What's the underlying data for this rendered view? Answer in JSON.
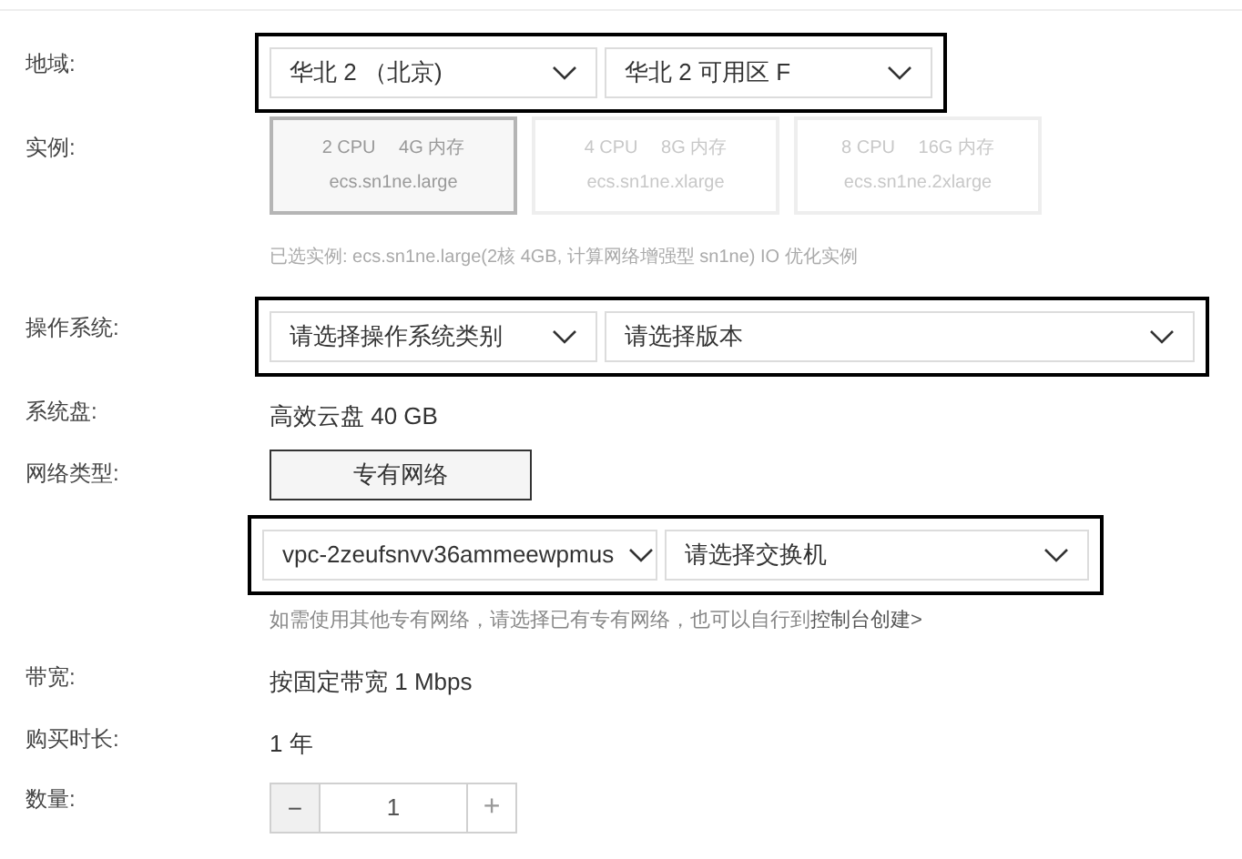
{
  "fields": [
    {
      "kind": "selects",
      "label": "地域:",
      "outlined": true,
      "selects": [
        {
          "text": "华北 2 （北京)",
          "wide": false
        },
        {
          "text": "华北 2 可用区 F",
          "wide": false
        }
      ]
    },
    {
      "kind": "instances",
      "label": "实例:",
      "options": [
        {
          "spec": "2 CPU　 4G 内存",
          "type": "ecs.sn1ne.large",
          "selected": true
        },
        {
          "spec": "4 CPU　 8G 内存",
          "type": "ecs.sn1ne.xlarge",
          "selected": false
        },
        {
          "spec": "8 CPU　 16G 内存",
          "type": "ecs.sn1ne.2xlarge",
          "selected": false
        }
      ],
      "note": "已选实例: ecs.sn1ne.large(2核 4GB, 计算网络增强型 sn1ne) IO 优化实例"
    },
    {
      "kind": "selects",
      "label": "操作系统:",
      "outlined": true,
      "selects": [
        {
          "text": "请选择操作系统类别",
          "wide": false
        },
        {
          "text": "请选择版本",
          "wide": true
        }
      ]
    },
    {
      "kind": "text",
      "label": "系统盘:",
      "value": "高效云盘 40 GB"
    },
    {
      "kind": "network",
      "label": "网络类型:",
      "button": "专有网络",
      "outlined": true,
      "selects": [
        {
          "text": "vpc-2zeufsnvv36ammeewpmus",
          "wide": false
        },
        {
          "text": "请选择交换机",
          "wide": true
        }
      ],
      "hint": "如需使用其他专有网络，请选择已有专有网络，也可以自行到",
      "link": "控制台创建>"
    },
    {
      "kind": "text",
      "label": "带宽:",
      "value": "按固定带宽 1 Mbps"
    },
    {
      "kind": "text",
      "label": "购买时长:",
      "value": "1 年"
    },
    {
      "kind": "stepper",
      "label": "数量:",
      "minus": "−",
      "value": "1",
      "plus": "+"
    }
  ]
}
